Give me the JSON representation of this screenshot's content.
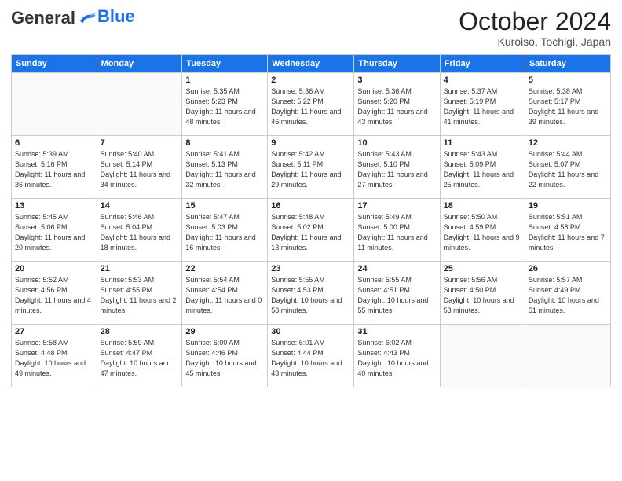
{
  "header": {
    "logo_line1": "General",
    "logo_line2": "Blue",
    "month": "October 2024",
    "location": "Kuroiso, Tochigi, Japan"
  },
  "weekdays": [
    "Sunday",
    "Monday",
    "Tuesday",
    "Wednesday",
    "Thursday",
    "Friday",
    "Saturday"
  ],
  "weeks": [
    [
      {
        "day": "",
        "info": ""
      },
      {
        "day": "",
        "info": ""
      },
      {
        "day": "1",
        "info": "Sunrise: 5:35 AM\nSunset: 5:23 PM\nDaylight: 11 hours and 48 minutes."
      },
      {
        "day": "2",
        "info": "Sunrise: 5:36 AM\nSunset: 5:22 PM\nDaylight: 11 hours and 46 minutes."
      },
      {
        "day": "3",
        "info": "Sunrise: 5:36 AM\nSunset: 5:20 PM\nDaylight: 11 hours and 43 minutes."
      },
      {
        "day": "4",
        "info": "Sunrise: 5:37 AM\nSunset: 5:19 PM\nDaylight: 11 hours and 41 minutes."
      },
      {
        "day": "5",
        "info": "Sunrise: 5:38 AM\nSunset: 5:17 PM\nDaylight: 11 hours and 39 minutes."
      }
    ],
    [
      {
        "day": "6",
        "info": "Sunrise: 5:39 AM\nSunset: 5:16 PM\nDaylight: 11 hours and 36 minutes."
      },
      {
        "day": "7",
        "info": "Sunrise: 5:40 AM\nSunset: 5:14 PM\nDaylight: 11 hours and 34 minutes."
      },
      {
        "day": "8",
        "info": "Sunrise: 5:41 AM\nSunset: 5:13 PM\nDaylight: 11 hours and 32 minutes."
      },
      {
        "day": "9",
        "info": "Sunrise: 5:42 AM\nSunset: 5:11 PM\nDaylight: 11 hours and 29 minutes."
      },
      {
        "day": "10",
        "info": "Sunrise: 5:43 AM\nSunset: 5:10 PM\nDaylight: 11 hours and 27 minutes."
      },
      {
        "day": "11",
        "info": "Sunrise: 5:43 AM\nSunset: 5:09 PM\nDaylight: 11 hours and 25 minutes."
      },
      {
        "day": "12",
        "info": "Sunrise: 5:44 AM\nSunset: 5:07 PM\nDaylight: 11 hours and 22 minutes."
      }
    ],
    [
      {
        "day": "13",
        "info": "Sunrise: 5:45 AM\nSunset: 5:06 PM\nDaylight: 11 hours and 20 minutes."
      },
      {
        "day": "14",
        "info": "Sunrise: 5:46 AM\nSunset: 5:04 PM\nDaylight: 11 hours and 18 minutes."
      },
      {
        "day": "15",
        "info": "Sunrise: 5:47 AM\nSunset: 5:03 PM\nDaylight: 11 hours and 16 minutes."
      },
      {
        "day": "16",
        "info": "Sunrise: 5:48 AM\nSunset: 5:02 PM\nDaylight: 11 hours and 13 minutes."
      },
      {
        "day": "17",
        "info": "Sunrise: 5:49 AM\nSunset: 5:00 PM\nDaylight: 11 hours and 11 minutes."
      },
      {
        "day": "18",
        "info": "Sunrise: 5:50 AM\nSunset: 4:59 PM\nDaylight: 11 hours and 9 minutes."
      },
      {
        "day": "19",
        "info": "Sunrise: 5:51 AM\nSunset: 4:58 PM\nDaylight: 11 hours and 7 minutes."
      }
    ],
    [
      {
        "day": "20",
        "info": "Sunrise: 5:52 AM\nSunset: 4:56 PM\nDaylight: 11 hours and 4 minutes."
      },
      {
        "day": "21",
        "info": "Sunrise: 5:53 AM\nSunset: 4:55 PM\nDaylight: 11 hours and 2 minutes."
      },
      {
        "day": "22",
        "info": "Sunrise: 5:54 AM\nSunset: 4:54 PM\nDaylight: 11 hours and 0 minutes."
      },
      {
        "day": "23",
        "info": "Sunrise: 5:55 AM\nSunset: 4:53 PM\nDaylight: 10 hours and 58 minutes."
      },
      {
        "day": "24",
        "info": "Sunrise: 5:55 AM\nSunset: 4:51 PM\nDaylight: 10 hours and 55 minutes."
      },
      {
        "day": "25",
        "info": "Sunrise: 5:56 AM\nSunset: 4:50 PM\nDaylight: 10 hours and 53 minutes."
      },
      {
        "day": "26",
        "info": "Sunrise: 5:57 AM\nSunset: 4:49 PM\nDaylight: 10 hours and 51 minutes."
      }
    ],
    [
      {
        "day": "27",
        "info": "Sunrise: 5:58 AM\nSunset: 4:48 PM\nDaylight: 10 hours and 49 minutes."
      },
      {
        "day": "28",
        "info": "Sunrise: 5:59 AM\nSunset: 4:47 PM\nDaylight: 10 hours and 47 minutes."
      },
      {
        "day": "29",
        "info": "Sunrise: 6:00 AM\nSunset: 4:46 PM\nDaylight: 10 hours and 45 minutes."
      },
      {
        "day": "30",
        "info": "Sunrise: 6:01 AM\nSunset: 4:44 PM\nDaylight: 10 hours and 43 minutes."
      },
      {
        "day": "31",
        "info": "Sunrise: 6:02 AM\nSunset: 4:43 PM\nDaylight: 10 hours and 40 minutes."
      },
      {
        "day": "",
        "info": ""
      },
      {
        "day": "",
        "info": ""
      }
    ]
  ]
}
